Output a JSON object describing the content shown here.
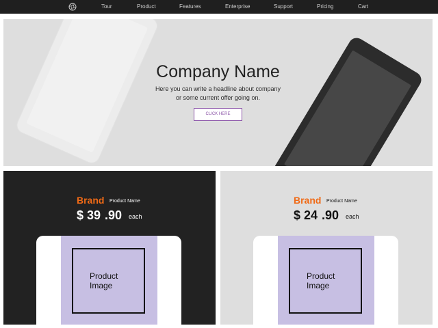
{
  "nav": {
    "logo_icon": "aperture-icon",
    "items": [
      {
        "label": "Tour"
      },
      {
        "label": "Product"
      },
      {
        "label": "Features"
      },
      {
        "label": "Enterprise"
      },
      {
        "label": "Support"
      },
      {
        "label": "Pricing"
      },
      {
        "label": "Cart"
      }
    ]
  },
  "hero": {
    "title": "Company Name",
    "lines": [
      "Here you can write a headline about company",
      "or some current offer going on."
    ],
    "button_label": "CLICK HERE"
  },
  "products": [
    {
      "brand": "Brand",
      "name": "Product Name",
      "currency": "$",
      "price_whole": "39",
      "price_cents": ".90",
      "unit": "each",
      "image_label": "Product Image"
    },
    {
      "brand": "Brand",
      "name": "Product Name",
      "currency": "$",
      "price_whole": "24",
      "price_cents": ".90",
      "unit": "each",
      "image_label": "Product Image"
    }
  ],
  "colors": {
    "navbar": "#1f1f1f",
    "hero_bg": "#dedede",
    "brand_orange": "#f06a16",
    "button_purple": "#8b54a8",
    "image_purple": "#c7bfe3",
    "dark_card": "#222222"
  }
}
